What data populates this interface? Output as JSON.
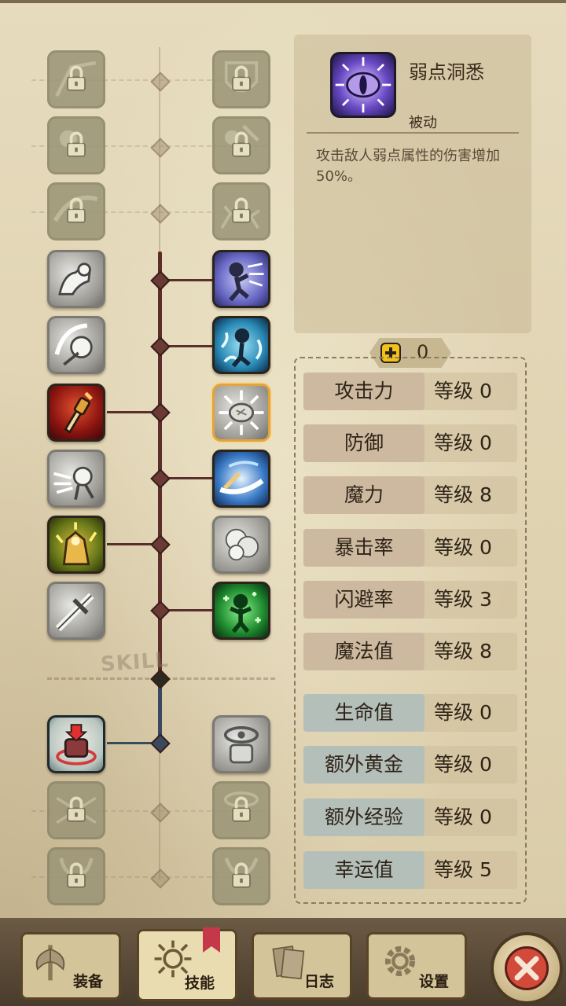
{
  "skill_detail": {
    "name": "弱点洞悉",
    "type": "被动",
    "description": "攻击敌人弱点属性的伤害增加50%。",
    "icon": "purple-eye-icon"
  },
  "skill_points": {
    "value": "0",
    "icon": "plus-icon"
  },
  "tree_watermark": "SKILL",
  "skill_tree": {
    "left": [
      {
        "icon": "locked-wings-icon",
        "state": "locked"
      },
      {
        "icon": "locked-skull-icon",
        "state": "locked"
      },
      {
        "icon": "locked-slash-icon",
        "state": "locked"
      },
      {
        "icon": "fist-icon",
        "state": "unlearned"
      },
      {
        "icon": "spin-slash-icon",
        "state": "unlearned"
      },
      {
        "icon": "red-dagger-icon",
        "state": "learned"
      },
      {
        "icon": "dash-stickman-icon",
        "state": "unlearned"
      },
      {
        "icon": "golden-power-icon",
        "state": "learned"
      },
      {
        "icon": "cross-sword-icon",
        "state": "unlearned"
      },
      {
        "icon": "red-armor-icon",
        "state": "learned"
      },
      {
        "icon": "locked-web-icon",
        "state": "locked"
      },
      {
        "icon": "locked-horns-icon",
        "state": "locked"
      }
    ],
    "right": [
      {
        "icon": "locked-shield-icon",
        "state": "locked"
      },
      {
        "icon": "locked-fist-icon",
        "state": "locked"
      },
      {
        "icon": "locked-shards-icon",
        "state": "locked"
      },
      {
        "icon": "stickman-run-icon",
        "state": "learned"
      },
      {
        "icon": "water-stickman-icon",
        "state": "learned"
      },
      {
        "icon": "weak-eye-icon",
        "state": "selected"
      },
      {
        "icon": "blue-sword-slash-icon",
        "state": "learned"
      },
      {
        "icon": "smoke-cloud-icon",
        "state": "unlearned"
      },
      {
        "icon": "green-clover-icon",
        "state": "learned"
      },
      {
        "icon": "eye-armor-icon",
        "state": "unlearned"
      },
      {
        "icon": "locked-eye-icon",
        "state": "locked"
      },
      {
        "icon": "locked-bones-icon",
        "state": "locked"
      }
    ]
  },
  "stats_group1": [
    {
      "name": "攻击力",
      "level": "等级 0"
    },
    {
      "name": "防御",
      "level": "等级 0"
    },
    {
      "name": "魔力",
      "level": "等级 8"
    },
    {
      "name": "暴击率",
      "level": "等级 0"
    },
    {
      "name": "闪避率",
      "level": "等级 3"
    },
    {
      "name": "魔法值",
      "level": "等级 8"
    }
  ],
  "stats_group2": [
    {
      "name": "生命值",
      "level": "等级 0"
    },
    {
      "name": "额外黄金",
      "level": "等级 0"
    },
    {
      "name": "额外经验",
      "level": "等级 0"
    },
    {
      "name": "幸运值",
      "level": "等级 5"
    }
  ],
  "tabs": [
    {
      "label": "装备",
      "icon": "axe-icon"
    },
    {
      "label": "技能",
      "icon": "skill-burst-icon"
    },
    {
      "label": "日志",
      "icon": "journal-icon"
    },
    {
      "label": "设置",
      "icon": "gear-icon"
    }
  ],
  "close_icon": "close-x-icon"
}
